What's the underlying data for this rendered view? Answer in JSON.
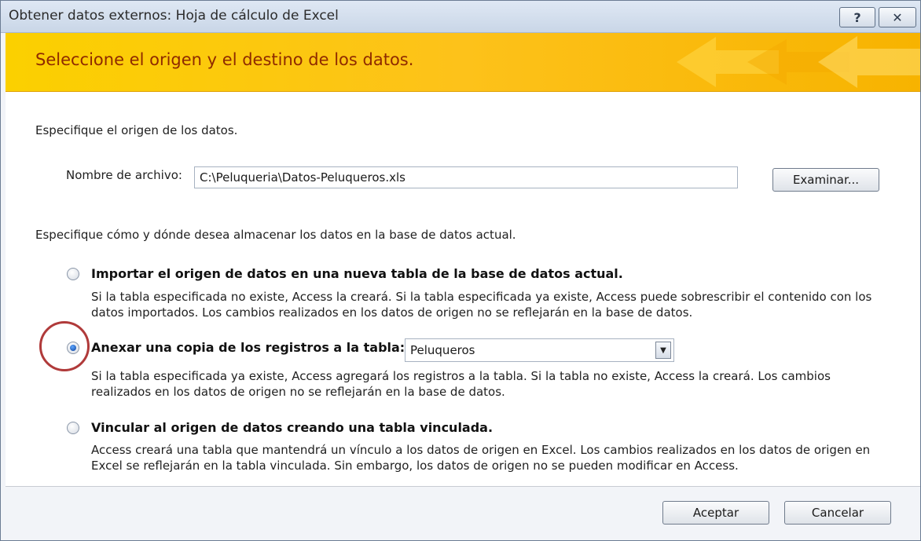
{
  "window": {
    "title": "Obtener datos externos: Hoja de cálculo de Excel",
    "help_label": "?",
    "close_label": "✕"
  },
  "banner": {
    "title": "Seleccione el origen y el destino de los datos."
  },
  "source": {
    "intro": "Especifique el origen de los datos.",
    "file_label": "Nombre de archivo:",
    "file_value": "C:\\Peluqueria\\Datos-Peluqueros.xls",
    "browse_label": "Examinar..."
  },
  "storage": {
    "intro": "Especifique cómo y dónde desea almacenar los datos en la base de datos actual.",
    "options": [
      {
        "label": "Importar el origen de datos en una nueva tabla de la base de datos actual.",
        "desc_line1": "Si la tabla especificada no existe, Access la creará. Si la tabla especificada ya existe, Access puede sobrescribir el contenido con los",
        "desc_line2": "datos importados. Los cambios realizados en los datos de origen no se reflejarán en la base de datos.",
        "checked": false
      },
      {
        "label": "Anexar una copia de los registros a la tabla:",
        "desc_line1": "Si la tabla especificada ya existe, Access agregará los registros a la tabla. Si la tabla no existe, Access la creará. Los cambios",
        "desc_line2": "realizados en los datos de origen no se reflejarán en la base de datos.",
        "checked": true,
        "table_value": "Peluqueros"
      },
      {
        "label": "Vincular al origen de datos creando una tabla vinculada.",
        "desc_line1": "Access creará una tabla que mantendrá un vínculo a los datos de origen en Excel. Los cambios realizados en los datos de origen en",
        "desc_line2": "Excel se reflejarán en la tabla vinculada. Sin embargo, los datos de origen no se pueden modificar en Access.",
        "checked": false
      }
    ]
  },
  "footer": {
    "ok_label": "Aceptar",
    "cancel_label": "Cancelar"
  },
  "colors": {
    "banner": "#fdc21a",
    "banner_text": "#8f2a00",
    "annotation_ring": "#b03a3a"
  }
}
